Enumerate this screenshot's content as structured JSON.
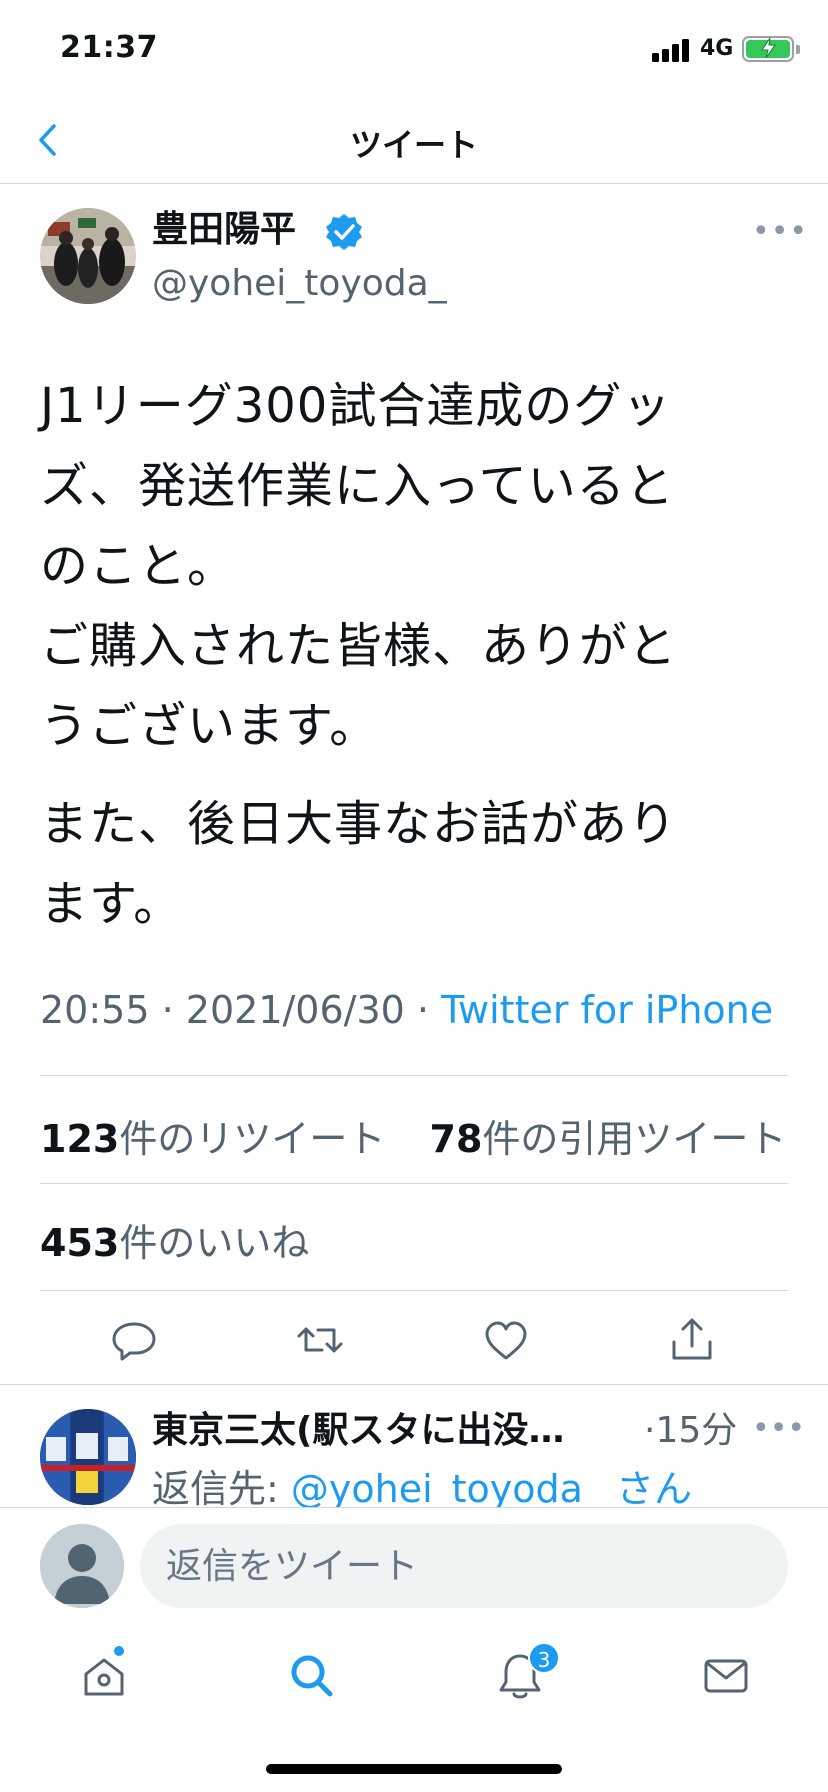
{
  "status_bar": {
    "time": "21:37",
    "network": "4G"
  },
  "header": {
    "title": "ツイート"
  },
  "tweet": {
    "author_name": "豊田陽平",
    "author_handle": "@yohei_toyoda_",
    "verified": true,
    "text_lines": [
      "J1リーグ300試合達成のグッ",
      "ズ、発送作業に入っていると",
      "のこと。",
      "ご購入された皆様、ありがと",
      "うございます。",
      "また、後日大事なお話があり",
      "ます。"
    ],
    "time": "20:55",
    "date": "2021/06/30",
    "separator": "·",
    "source": "Twitter for iPhone",
    "retweets_count": "123",
    "retweets_label": "件のリツイート",
    "quotes_count": "78",
    "quotes_label": "件の引用ツイート",
    "likes_count": "453",
    "likes_label": "件のいいね"
  },
  "reply": {
    "author_name": "東京三太(駅スタに出没…",
    "time": "·15分",
    "reply_prefix": "返信先: ",
    "reply_mention": "@yohei_toyoda_",
    "reply_suffix": "さん"
  },
  "composer": {
    "placeholder": "返信をツイート"
  },
  "tabbar": {
    "notifications_badge": "3"
  },
  "colors": {
    "accent": "#1d9bf0",
    "text": "#0f1419",
    "muted": "#536471",
    "divider": "#cfd9de"
  },
  "icons": {
    "back": "chevron-left-icon",
    "verified": "verified-badge-icon",
    "more": "more-horizontal-icon",
    "reply": "reply-icon",
    "retweet": "retweet-icon",
    "like": "heart-icon",
    "share": "share-icon",
    "home": "home-icon",
    "search": "search-icon",
    "notifications": "bell-icon",
    "messages": "mail-icon"
  }
}
